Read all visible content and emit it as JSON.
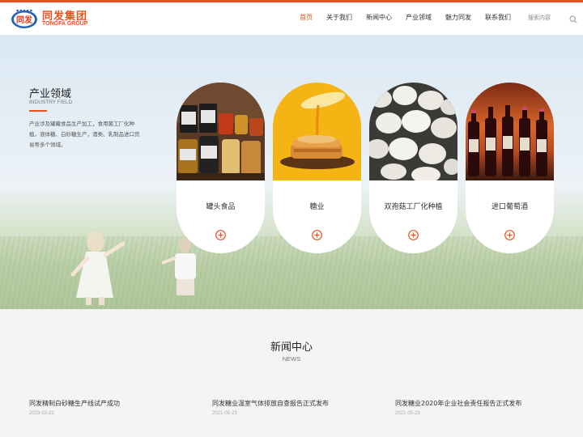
{
  "header": {
    "logo_cn": "同发集团",
    "logo_en": "TONGFA GROUP",
    "logo_badge_text": "同发",
    "nav": [
      "首页",
      "关于我们",
      "新闻中心",
      "产业领域",
      "魅力同发",
      "联系我们"
    ],
    "active_nav": "首页",
    "search_label": "搜索内容"
  },
  "hero": {
    "title": "产业领域",
    "subtitle": "INDUSTRY FIELD",
    "description": "产业涉及罐藏食品生产加工，食用菌工厂化种植，液体糖、白砂糖生产，酒类、乳制品进口贸易等多个领域。",
    "cards": [
      {
        "label": "罐头食品",
        "image": "canned-food-jars"
      },
      {
        "label": "糖业",
        "image": "honey-pancakes"
      },
      {
        "label": "双孢菇工厂化种植",
        "image": "white-mushrooms"
      },
      {
        "label": "进口葡萄酒",
        "image": "wine-bottles"
      }
    ]
  },
  "news": {
    "title": "新闻中心",
    "subtitle": "NEWS",
    "items": [
      {
        "title": "同发精制白砂糖生产线试产成功",
        "date": "2023-03-23"
      },
      {
        "title": "同发糖业温室气体排放自查报告正式发布",
        "date": "2021-05-23"
      },
      {
        "title": "同发糖业2020年企业社会责任报告正式发布",
        "date": "2021-05-23"
      }
    ]
  },
  "colors": {
    "accent": "#e9521d",
    "news_bg": "#f4f4f4"
  }
}
